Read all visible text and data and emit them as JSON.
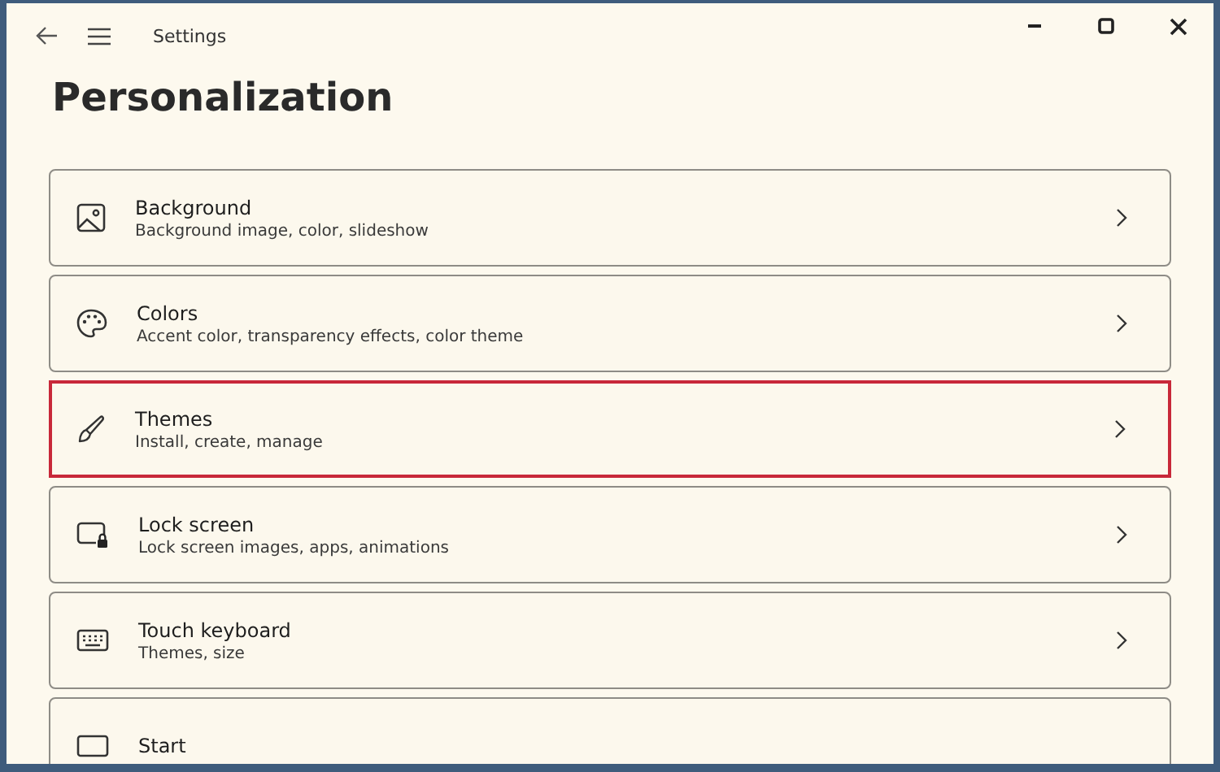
{
  "window": {
    "title": "Settings"
  },
  "page": {
    "heading": "Personalization"
  },
  "items": [
    {
      "kind": "image",
      "title": "Background",
      "subtitle": "Background image, color, slideshow",
      "highlighted": false
    },
    {
      "kind": "palette",
      "title": "Colors",
      "subtitle": "Accent color, transparency effects, color theme",
      "highlighted": false
    },
    {
      "kind": "brush",
      "title": "Themes",
      "subtitle": "Install, create, manage",
      "highlighted": true
    },
    {
      "kind": "lock",
      "title": "Lock screen",
      "subtitle": "Lock screen images, apps, animations",
      "highlighted": false
    },
    {
      "kind": "keyboard",
      "title": "Touch keyboard",
      "subtitle": "Themes, size",
      "highlighted": false
    },
    {
      "kind": "start",
      "title": "Start",
      "highlighted": false
    }
  ]
}
